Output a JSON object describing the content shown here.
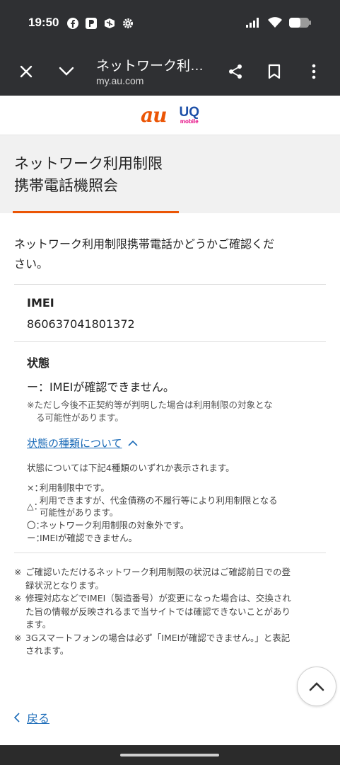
{
  "status_bar": {
    "time": "19:50",
    "left_icons": [
      "facebook-icon",
      "parking-app-icon",
      "chat-app-icon",
      "settings-gear-icon"
    ],
    "right_icons": [
      "signal-icon",
      "wifi-icon",
      "battery-icon"
    ]
  },
  "toolbar": {
    "title": "ネットワーク利…",
    "url": "my.au.com"
  },
  "brand": {
    "au": "au",
    "uq": "UQ",
    "uq_sub": "mobile",
    "au_color": "#eb5505",
    "uq_color": "#1c4fa7"
  },
  "page": {
    "title_line1": "ネットワーク利用制限",
    "title_line2": "携帯電話機照会",
    "intro_line1": "ネットワーク利用制限携帯電話かどうかご確認くだ",
    "intro_line2": "さい。",
    "imei_label": "IMEI",
    "imei_value": "860637041801372",
    "status_label": "状態",
    "status_value": "ー：IMEIが確認できません。",
    "status_note_line1": "※ただし今後不正契約等が判明した場合は利用制限の対象とな",
    "status_note_line2": "る可能性があります。",
    "types_link": "状態の種類について",
    "types_intro": "状態については下記4種類のいずれか表示されます。",
    "legend": [
      {
        "symbol": "×：",
        "line1": "利用制限中です。",
        "line2": ""
      },
      {
        "symbol": "△：",
        "line1": "利用できますが、代金債務の不履行等により利用制限となる",
        "line2": "可能性があります。"
      },
      {
        "symbol": "〇：",
        "line1": "ネットワーク利用制限の対象外です。",
        "line2": ""
      },
      {
        "symbol": "ー：",
        "line1": "IMEIが確認できません。",
        "line2": ""
      }
    ],
    "footnotes": [
      {
        "mark": "※",
        "line1": "ご確認いただけるネットワーク利用制限の状況はご確認前日での登",
        "line2": "録状況となります。",
        "line3": ""
      },
      {
        "mark": "※",
        "line1": "修理対応などでIMEI（製造番号）が変更になった場合は、交換され",
        "line2": "た旨の情報が反映されるまで当サイトでは確認できないことがあり",
        "line3": "ます。"
      },
      {
        "mark": "※",
        "line1": "3Gスマートフォンの場合は必ず「IMEIが確認できません。」と表記",
        "line2": "されます。",
        "line3": ""
      }
    ],
    "back_label": "戻る",
    "accent_color": "#eb5505",
    "link_color": "#1b6bb8"
  }
}
